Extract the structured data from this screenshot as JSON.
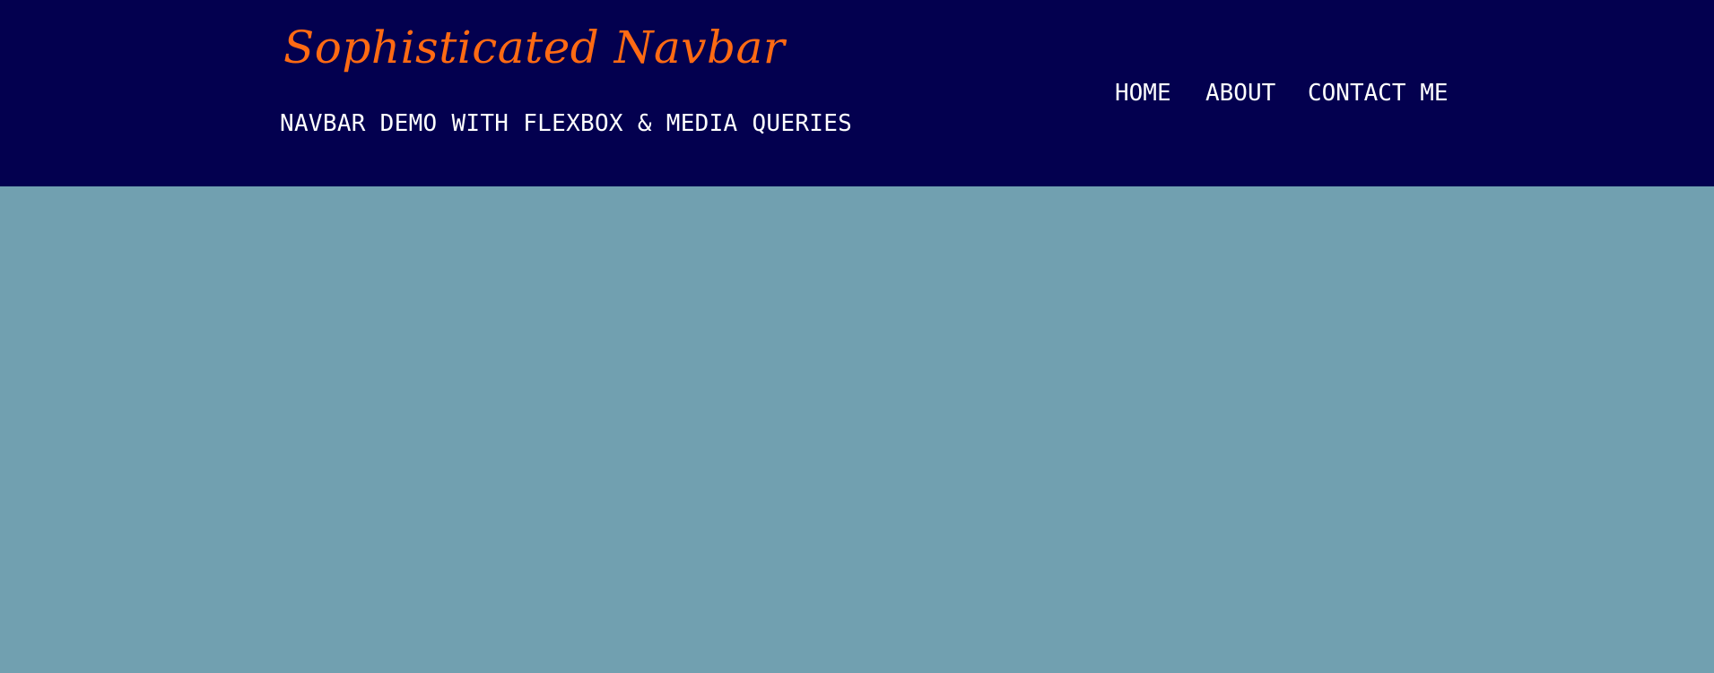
{
  "header": {
    "brand_title": "Sophisticated Navbar",
    "brand_subtitle": "NAVBAR DEMO WITH FLEXBOX & MEDIA QUERIES",
    "background_color": "#03004f",
    "title_color": "#ff6a13",
    "text_color": "#ffffff"
  },
  "nav": {
    "items": [
      {
        "label": "HOME"
      },
      {
        "label": "ABOUT"
      },
      {
        "label": "CONTACT ME"
      }
    ]
  },
  "main": {
    "background_color": "#71a0b0"
  }
}
